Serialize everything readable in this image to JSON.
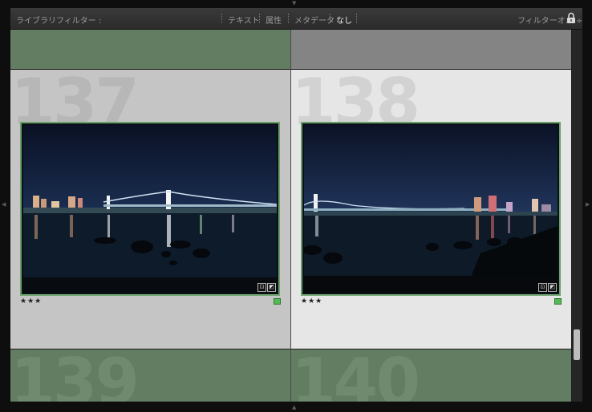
{
  "filter_bar": {
    "title": "ライブラリフィルター :",
    "tabs": [
      {
        "label": "テキスト",
        "active": false
      },
      {
        "label": "属性",
        "active": false
      },
      {
        "label": "メタデータ",
        "active": false
      },
      {
        "label": "なし",
        "active": true
      }
    ],
    "preset": "フィルターオ… ÷",
    "lock_icon": "padlock-icon"
  },
  "cells": [
    {
      "number": "137",
      "stars": "★★★",
      "color_label": "#56b856",
      "selected": true,
      "badges": [
        "metadata-icon",
        "edit-icon"
      ]
    },
    {
      "number": "138",
      "stars": "★★★",
      "color_label": "#56b856",
      "selected": false,
      "badges": [
        "metadata-icon",
        "edit-icon"
      ]
    },
    {
      "number": "139"
    },
    {
      "number": "140"
    }
  ],
  "colors": {
    "selected_label_bg": "#637d63",
    "selected_cell_bg": "#c5c5c5",
    "unselected_cell_bg": "#e6e6e6",
    "gray_band": "#848484"
  }
}
